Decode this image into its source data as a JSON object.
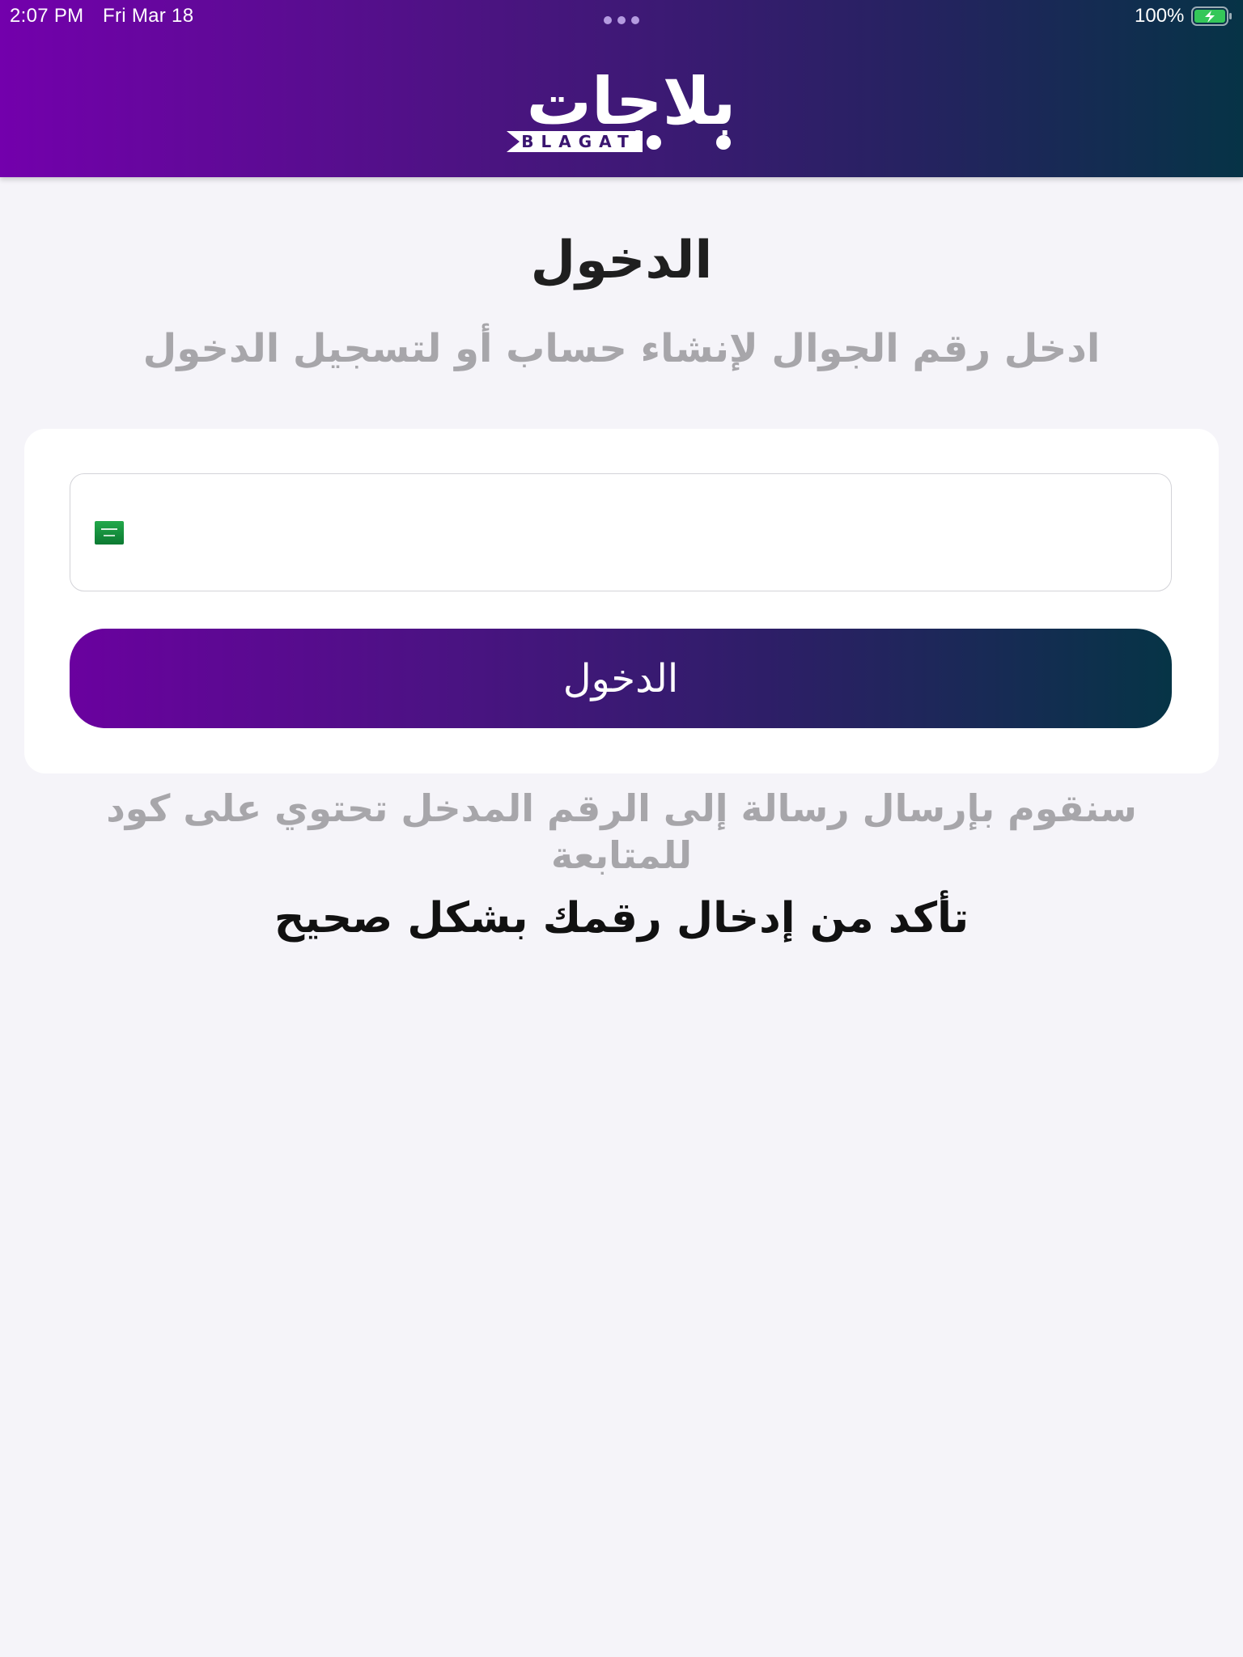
{
  "status_bar": {
    "time": "2:07 PM",
    "date": "Fri Mar 18",
    "battery_percent": "100%",
    "battery_icon": "battery-charging-icon"
  },
  "header": {
    "logo_arabic": "بلاجات",
    "logo_latin": "BLAGAT",
    "gradient_colors": [
      "#7300ac",
      "#063346"
    ]
  },
  "login": {
    "title": "الدخول",
    "subtitle": "ادخل رقم الجوال لإنشاء حساب أو لتسجيل الدخول",
    "phone_field": {
      "value": "",
      "placeholder": "",
      "country_flag_icon": "saudi-flag-icon"
    },
    "button_label": "الدخول",
    "info": "سنقوم بإرسال رسالة إلى الرقم المدخل تحتوي على كود للمتابعة",
    "warning": "تأكد من إدخال رقمك بشكل صحيح"
  }
}
